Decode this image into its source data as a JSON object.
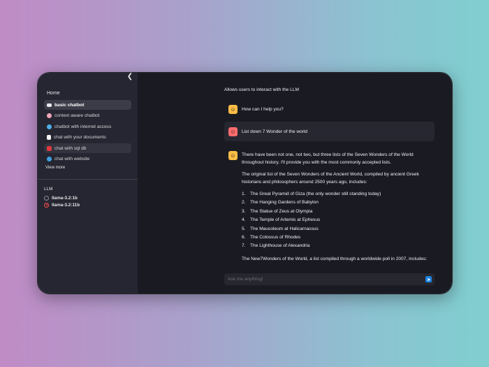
{
  "sidebar": {
    "home_label": "Home",
    "items": [
      {
        "label": "basic chatbot",
        "icon": "keyboard-icon",
        "icon_color": "#e8e8ee"
      },
      {
        "label": "context aware chatbot",
        "icon": "brain-icon",
        "icon_color": "#f2a7b8"
      },
      {
        "label": "chatbot with internet access",
        "icon": "globe-icon",
        "icon_color": "#4fb0e8"
      },
      {
        "label": "chat with your documents",
        "icon": "document-icon",
        "icon_color": "#f4f4f4"
      },
      {
        "label": "chat with sql db",
        "icon": "database-icon",
        "icon_color": "#e0393e"
      },
      {
        "label": "chat with website",
        "icon": "globe-icon",
        "icon_color": "#3fa0e0"
      }
    ],
    "view_more_label": "View more",
    "llm_label": "LLM",
    "llm_options": [
      {
        "label": "llama-3.2:1b",
        "selected": false
      },
      {
        "label": "llama-3.2:11b",
        "selected": true
      }
    ]
  },
  "main": {
    "description": "Allows users to interact with the LLM",
    "messages": {
      "assistant_greeting": "How can I help you?",
      "user_query": "List down 7 Wonder of the world",
      "assistant_intro": "There have been not one, not two, but three lists of the Seven Wonders of the World throughout history. I'll provide you with the most commonly accepted lists.",
      "assistant_para2": "The original list of the Seven Wonders of the Ancient World, compiled by ancient Greek historians and philosophers around 2500 years ago, includes:",
      "wonders": [
        {
          "num": "1.",
          "text": "The Great Pyramid of Giza (the only wonder still standing today)"
        },
        {
          "num": "2.",
          "text": "The Hanging Gardens of Babylon"
        },
        {
          "num": "3.",
          "text": "The Statue of Zeus at Olympia"
        },
        {
          "num": "4.",
          "text": "The Temple of Artemis at Ephesus"
        },
        {
          "num": "5.",
          "text": "The Mausoleum at Halicarnassus"
        },
        {
          "num": "6.",
          "text": "The Colossus of Rhodes"
        },
        {
          "num": "7.",
          "text": "The Lighthouse of Alexandria"
        }
      ],
      "assistant_para3": "The New7Wonders of the World, a list compiled through a worldwide poll in 2007, includes:"
    },
    "chat_input": {
      "placeholder": "Ask me anything!",
      "value": ""
    }
  },
  "colors": {
    "accent_red": "#ff4b4b",
    "send_blue": "#1c83e1",
    "bot_avatar": "#ffbd45",
    "user_avatar": "#ff6c6c"
  }
}
